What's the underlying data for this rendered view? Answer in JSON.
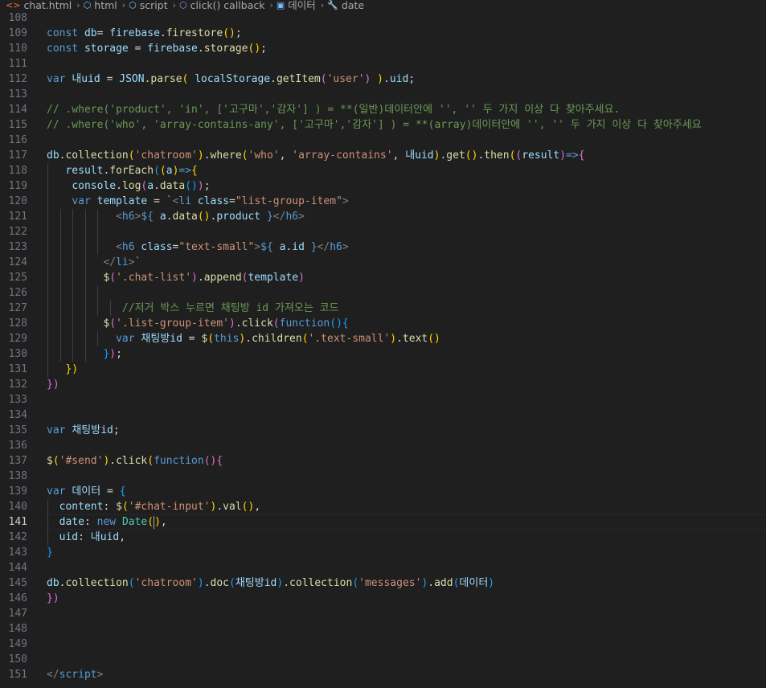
{
  "breadcrumb": {
    "items": [
      {
        "label": "chat.html",
        "icon": "html-file-icon",
        "glyph": "<>",
        "color": "#e37933"
      },
      {
        "label": "html",
        "icon": "element-icon",
        "glyph": "⬡",
        "color": "#75beff"
      },
      {
        "label": "script",
        "icon": "element-icon",
        "glyph": "⬡",
        "color": "#75beff"
      },
      {
        "label": "click() callback",
        "icon": "function-icon",
        "glyph": "⬡",
        "color": "#b180d7"
      },
      {
        "label": "데이터",
        "icon": "variable-icon",
        "glyph": "▣",
        "color": "#75beff"
      },
      {
        "label": "date",
        "icon": "property-icon",
        "glyph": "🔧",
        "color": "#cccccc"
      }
    ]
  },
  "editor": {
    "active_line": "141",
    "lines": [
      {
        "n": "108",
        "indent": 0,
        "t": []
      },
      {
        "n": "109",
        "indent": 0,
        "t": [
          [
            "kw",
            "const "
          ],
          [
            "vr",
            "db"
          ],
          [
            "",
            "="
          ],
          [
            "vr",
            " firebase"
          ],
          [
            "",
            "."
          ],
          [
            "fn",
            "firestore"
          ],
          [
            "b1",
            "()"
          ],
          [
            "",
            ";"
          ]
        ]
      },
      {
        "n": "110",
        "indent": 0,
        "t": [
          [
            "kw",
            "const "
          ],
          [
            "vr",
            "storage"
          ],
          [
            "",
            " = "
          ],
          [
            "vr",
            "firebase"
          ],
          [
            "",
            "."
          ],
          [
            "fn",
            "storage"
          ],
          [
            "b1",
            "()"
          ],
          [
            "",
            ";"
          ]
        ]
      },
      {
        "n": "111",
        "indent": 0,
        "t": []
      },
      {
        "n": "112",
        "indent": 0,
        "t": [
          [
            "kw",
            "var "
          ],
          [
            "vr",
            "내uid"
          ],
          [
            "",
            " = "
          ],
          [
            "vr",
            "JSON"
          ],
          [
            "",
            "."
          ],
          [
            "fn",
            "parse"
          ],
          [
            "b1",
            "( "
          ],
          [
            "vr",
            "localStorage"
          ],
          [
            "",
            "."
          ],
          [
            "fn",
            "getItem"
          ],
          [
            "b2",
            "("
          ],
          [
            "st",
            "'user'"
          ],
          [
            "b2",
            ")"
          ],
          [
            "b1",
            " )"
          ],
          [
            "",
            "."
          ],
          [
            "vr",
            "uid"
          ],
          [
            "",
            ";"
          ]
        ]
      },
      {
        "n": "113",
        "indent": 0,
        "t": []
      },
      {
        "n": "114",
        "indent": 0,
        "t": [
          [
            "cm",
            "// .where('product', 'in', ['고구마','감자'] ) = **(일반)데이터안에 '', '' 두 가지 이상 다 찾아주세요."
          ]
        ]
      },
      {
        "n": "115",
        "indent": 0,
        "t": [
          [
            "cm",
            "// .where('who', 'array-contains-any', ['고구마','감자'] ) = **(array)데이터안에 '', '' 두 가지 이상 다 찾아주세요"
          ]
        ]
      },
      {
        "n": "116",
        "indent": 0,
        "t": []
      },
      {
        "n": "117",
        "indent": 0,
        "t": [
          [
            "vr",
            "db"
          ],
          [
            "",
            "."
          ],
          [
            "fn",
            "collection"
          ],
          [
            "b1",
            "("
          ],
          [
            "st",
            "'chatroom'"
          ],
          [
            "b1",
            ")"
          ],
          [
            "",
            "."
          ],
          [
            "fn",
            "where"
          ],
          [
            "b1",
            "("
          ],
          [
            "st",
            "'who'"
          ],
          [
            "",
            ", "
          ],
          [
            "st",
            "'array-contains'"
          ],
          [
            "",
            ", "
          ],
          [
            "vr",
            "내uid"
          ],
          [
            "b1",
            ")"
          ],
          [
            "",
            "."
          ],
          [
            "fn",
            "get"
          ],
          [
            "b1",
            "()"
          ],
          [
            "",
            "."
          ],
          [
            "fn",
            "then"
          ],
          [
            "b1",
            "("
          ],
          [
            "b2",
            "("
          ],
          [
            "vr",
            "result"
          ],
          [
            "b2",
            ")"
          ],
          [
            "kw",
            "=>"
          ],
          [
            "b2",
            "{"
          ]
        ]
      },
      {
        "n": "118",
        "indent": 1,
        "t": [
          [
            "",
            "   "
          ],
          [
            "vr",
            "result"
          ],
          [
            "",
            "."
          ],
          [
            "fn",
            "forEach"
          ],
          [
            "b3",
            "("
          ],
          [
            "b1",
            "("
          ],
          [
            "vr",
            "a"
          ],
          [
            "b1",
            ")"
          ],
          [
            "kw",
            "=>"
          ],
          [
            "b1",
            "{"
          ]
        ]
      },
      {
        "n": "119",
        "indent": 1,
        "t": [
          [
            "",
            "    "
          ],
          [
            "vr",
            "console"
          ],
          [
            "",
            "."
          ],
          [
            "fn",
            "log"
          ],
          [
            "b2",
            "("
          ],
          [
            "vr",
            "a"
          ],
          [
            "",
            "."
          ],
          [
            "fn",
            "data"
          ],
          [
            "b3",
            "()"
          ],
          [
            "b2",
            ")"
          ],
          [
            "",
            ";"
          ]
        ]
      },
      {
        "n": "120",
        "indent": 1,
        "t": [
          [
            "",
            "    "
          ],
          [
            "kw",
            "var "
          ],
          [
            "vr",
            "template"
          ],
          [
            "",
            " = "
          ],
          [
            "st",
            "`"
          ],
          [
            "tg",
            "<"
          ],
          [
            "tn",
            "li"
          ],
          [
            "at",
            " class"
          ],
          [
            "",
            "="
          ],
          [
            "st",
            "\"list-group-item\""
          ],
          [
            "tg",
            ">"
          ]
        ]
      },
      {
        "n": "121",
        "indent": 5,
        "t": [
          [
            "",
            "           "
          ],
          [
            "tg",
            "<"
          ],
          [
            "tn",
            "h6"
          ],
          [
            "tg",
            ">"
          ],
          [
            "tpl",
            "${"
          ],
          [
            "vr",
            " a"
          ],
          [
            "",
            "."
          ],
          [
            "fn",
            "data"
          ],
          [
            "b1",
            "()"
          ],
          [
            "",
            "."
          ],
          [
            "vr",
            "product "
          ],
          [
            "tpl",
            "}"
          ],
          [
            "tg",
            "</"
          ],
          [
            "tn",
            "h6"
          ],
          [
            "tg",
            ">"
          ]
        ]
      },
      {
        "n": "122",
        "indent": 5,
        "t": []
      },
      {
        "n": "123",
        "indent": 5,
        "t": [
          [
            "",
            "           "
          ],
          [
            "tg",
            "<"
          ],
          [
            "tn",
            "h6"
          ],
          [
            "at",
            " class"
          ],
          [
            "",
            "="
          ],
          [
            "st",
            "\"text-small\""
          ],
          [
            "tg",
            ">"
          ],
          [
            "tpl",
            "${"
          ],
          [
            "vr",
            " a"
          ],
          [
            "",
            "."
          ],
          [
            "vr",
            "id "
          ],
          [
            "tpl",
            "}"
          ],
          [
            "tg",
            "</"
          ],
          [
            "tn",
            "h6"
          ],
          [
            "tg",
            ">"
          ]
        ]
      },
      {
        "n": "124",
        "indent": 4,
        "t": [
          [
            "",
            "         "
          ],
          [
            "tg",
            "</"
          ],
          [
            "tn",
            "li"
          ],
          [
            "tg",
            ">"
          ],
          [
            "st",
            "`"
          ]
        ]
      },
      {
        "n": "125",
        "indent": 4,
        "t": [
          [
            "",
            "         "
          ],
          [
            "fn",
            "$"
          ],
          [
            "b2",
            "("
          ],
          [
            "st",
            "'.chat-list'"
          ],
          [
            "b2",
            ")"
          ],
          [
            "",
            "."
          ],
          [
            "fn",
            "append"
          ],
          [
            "b2",
            "("
          ],
          [
            "vr",
            "template"
          ],
          [
            "b2",
            ")"
          ]
        ]
      },
      {
        "n": "126",
        "indent": 5,
        "t": []
      },
      {
        "n": "127",
        "indent": 6,
        "t": [
          [
            "",
            "            "
          ],
          [
            "cm",
            "//저거 박스 누르면 채팅방 id 가져오는 코드"
          ]
        ]
      },
      {
        "n": "128",
        "indent": 4,
        "t": [
          [
            "",
            "         "
          ],
          [
            "fn",
            "$"
          ],
          [
            "b2",
            "("
          ],
          [
            "st",
            "'.list-group-item'"
          ],
          [
            "b2",
            ")"
          ],
          [
            "",
            "."
          ],
          [
            "fn",
            "click"
          ],
          [
            "b2",
            "("
          ],
          [
            "kw",
            "function"
          ],
          [
            "b3",
            "()"
          ],
          [
            "b3",
            "{"
          ]
        ]
      },
      {
        "n": "129",
        "indent": 5,
        "t": [
          [
            "",
            "           "
          ],
          [
            "kw",
            "var "
          ],
          [
            "vr",
            "채팅방id"
          ],
          [
            "",
            " = "
          ],
          [
            "fn",
            "$"
          ],
          [
            "b1",
            "("
          ],
          [
            "kw",
            "this"
          ],
          [
            "b1",
            ")"
          ],
          [
            "",
            "."
          ],
          [
            "fn",
            "children"
          ],
          [
            "b1",
            "("
          ],
          [
            "st",
            "'.text-small'"
          ],
          [
            "b1",
            ")"
          ],
          [
            "",
            "."
          ],
          [
            "fn",
            "text"
          ],
          [
            "b1",
            "()"
          ]
        ]
      },
      {
        "n": "130",
        "indent": 4,
        "t": [
          [
            "",
            "         "
          ],
          [
            "b3",
            "}"
          ],
          [
            "b2",
            ")"
          ],
          [
            "",
            ";"
          ]
        ]
      },
      {
        "n": "131",
        "indent": 1,
        "t": [
          [
            "",
            "   "
          ],
          [
            "b1",
            "})"
          ]
        ]
      },
      {
        "n": "132",
        "indent": 0,
        "t": [
          [
            "b2",
            "})"
          ]
        ]
      },
      {
        "n": "133",
        "indent": 0,
        "t": []
      },
      {
        "n": "134",
        "indent": 0,
        "t": []
      },
      {
        "n": "135",
        "indent": 0,
        "t": [
          [
            "kw",
            "var "
          ],
          [
            "vr",
            "채팅방id"
          ],
          [
            "",
            ";"
          ]
        ]
      },
      {
        "n": "136",
        "indent": 0,
        "t": []
      },
      {
        "n": "137",
        "indent": 0,
        "t": [
          [
            "fn",
            "$"
          ],
          [
            "b1",
            "("
          ],
          [
            "st",
            "'#send'"
          ],
          [
            "b1",
            ")"
          ],
          [
            "",
            "."
          ],
          [
            "fn",
            "click"
          ],
          [
            "b1",
            "("
          ],
          [
            "kw",
            "function"
          ],
          [
            "b2",
            "()"
          ],
          [
            "b2",
            "{"
          ]
        ]
      },
      {
        "n": "138",
        "indent": 0,
        "t": []
      },
      {
        "n": "139",
        "indent": 0,
        "t": [
          [
            "kw",
            "var "
          ],
          [
            "vr",
            "데이터"
          ],
          [
            "",
            " = "
          ],
          [
            "b3",
            "{"
          ]
        ]
      },
      {
        "n": "140",
        "indent": 1,
        "t": [
          [
            "",
            "  "
          ],
          [
            "vr",
            "content"
          ],
          [
            "",
            ": "
          ],
          [
            "fn",
            "$"
          ],
          [
            "b1",
            "("
          ],
          [
            "st",
            "'#chat-input'"
          ],
          [
            "b1",
            ")"
          ],
          [
            "",
            "."
          ],
          [
            "fn",
            "val"
          ],
          [
            "b1",
            "()"
          ],
          [
            "",
            ","
          ]
        ]
      },
      {
        "n": "141",
        "indent": 1,
        "t": [
          [
            "",
            "  "
          ],
          [
            "vr",
            "date"
          ],
          [
            "",
            ": "
          ],
          [
            "kw",
            "new "
          ],
          [
            "cl",
            "Date"
          ],
          [
            "b1",
            "("
          ],
          [
            "cur",
            ""
          ],
          [
            "b1",
            ")"
          ],
          [
            "",
            ","
          ]
        ]
      },
      {
        "n": "142",
        "indent": 1,
        "t": [
          [
            "",
            "  "
          ],
          [
            "vr",
            "uid"
          ],
          [
            "",
            ": "
          ],
          [
            "vr",
            "내uid"
          ],
          [
            "",
            ","
          ]
        ]
      },
      {
        "n": "143",
        "indent": 0,
        "t": [
          [
            "b3",
            "}"
          ]
        ]
      },
      {
        "n": "144",
        "indent": 0,
        "t": []
      },
      {
        "n": "145",
        "indent": 0,
        "t": [
          [
            "vr",
            "db"
          ],
          [
            "",
            "."
          ],
          [
            "fn",
            "collection"
          ],
          [
            "b3",
            "("
          ],
          [
            "st",
            "'chatroom'"
          ],
          [
            "b3",
            ")"
          ],
          [
            "",
            "."
          ],
          [
            "fn",
            "doc"
          ],
          [
            "b3",
            "("
          ],
          [
            "vr",
            "채팅방id"
          ],
          [
            "b3",
            ")"
          ],
          [
            "",
            "."
          ],
          [
            "fn",
            "collection"
          ],
          [
            "b3",
            "("
          ],
          [
            "st",
            "'messages'"
          ],
          [
            "b3",
            ")"
          ],
          [
            "",
            "."
          ],
          [
            "fn",
            "add"
          ],
          [
            "b3",
            "("
          ],
          [
            "vr",
            "데이터"
          ],
          [
            "b3",
            ")"
          ]
        ]
      },
      {
        "n": "146",
        "indent": 0,
        "t": [
          [
            "b2",
            "})"
          ]
        ]
      },
      {
        "n": "147",
        "indent": 0,
        "t": []
      },
      {
        "n": "148",
        "indent": 0,
        "t": []
      },
      {
        "n": "149",
        "indent": 0,
        "t": []
      },
      {
        "n": "150",
        "indent": 0,
        "t": []
      },
      {
        "n": "151",
        "indent": 0,
        "t": [
          [
            "tg",
            "</"
          ],
          [
            "tn",
            "script"
          ],
          [
            "tg",
            ">"
          ]
        ]
      }
    ]
  }
}
